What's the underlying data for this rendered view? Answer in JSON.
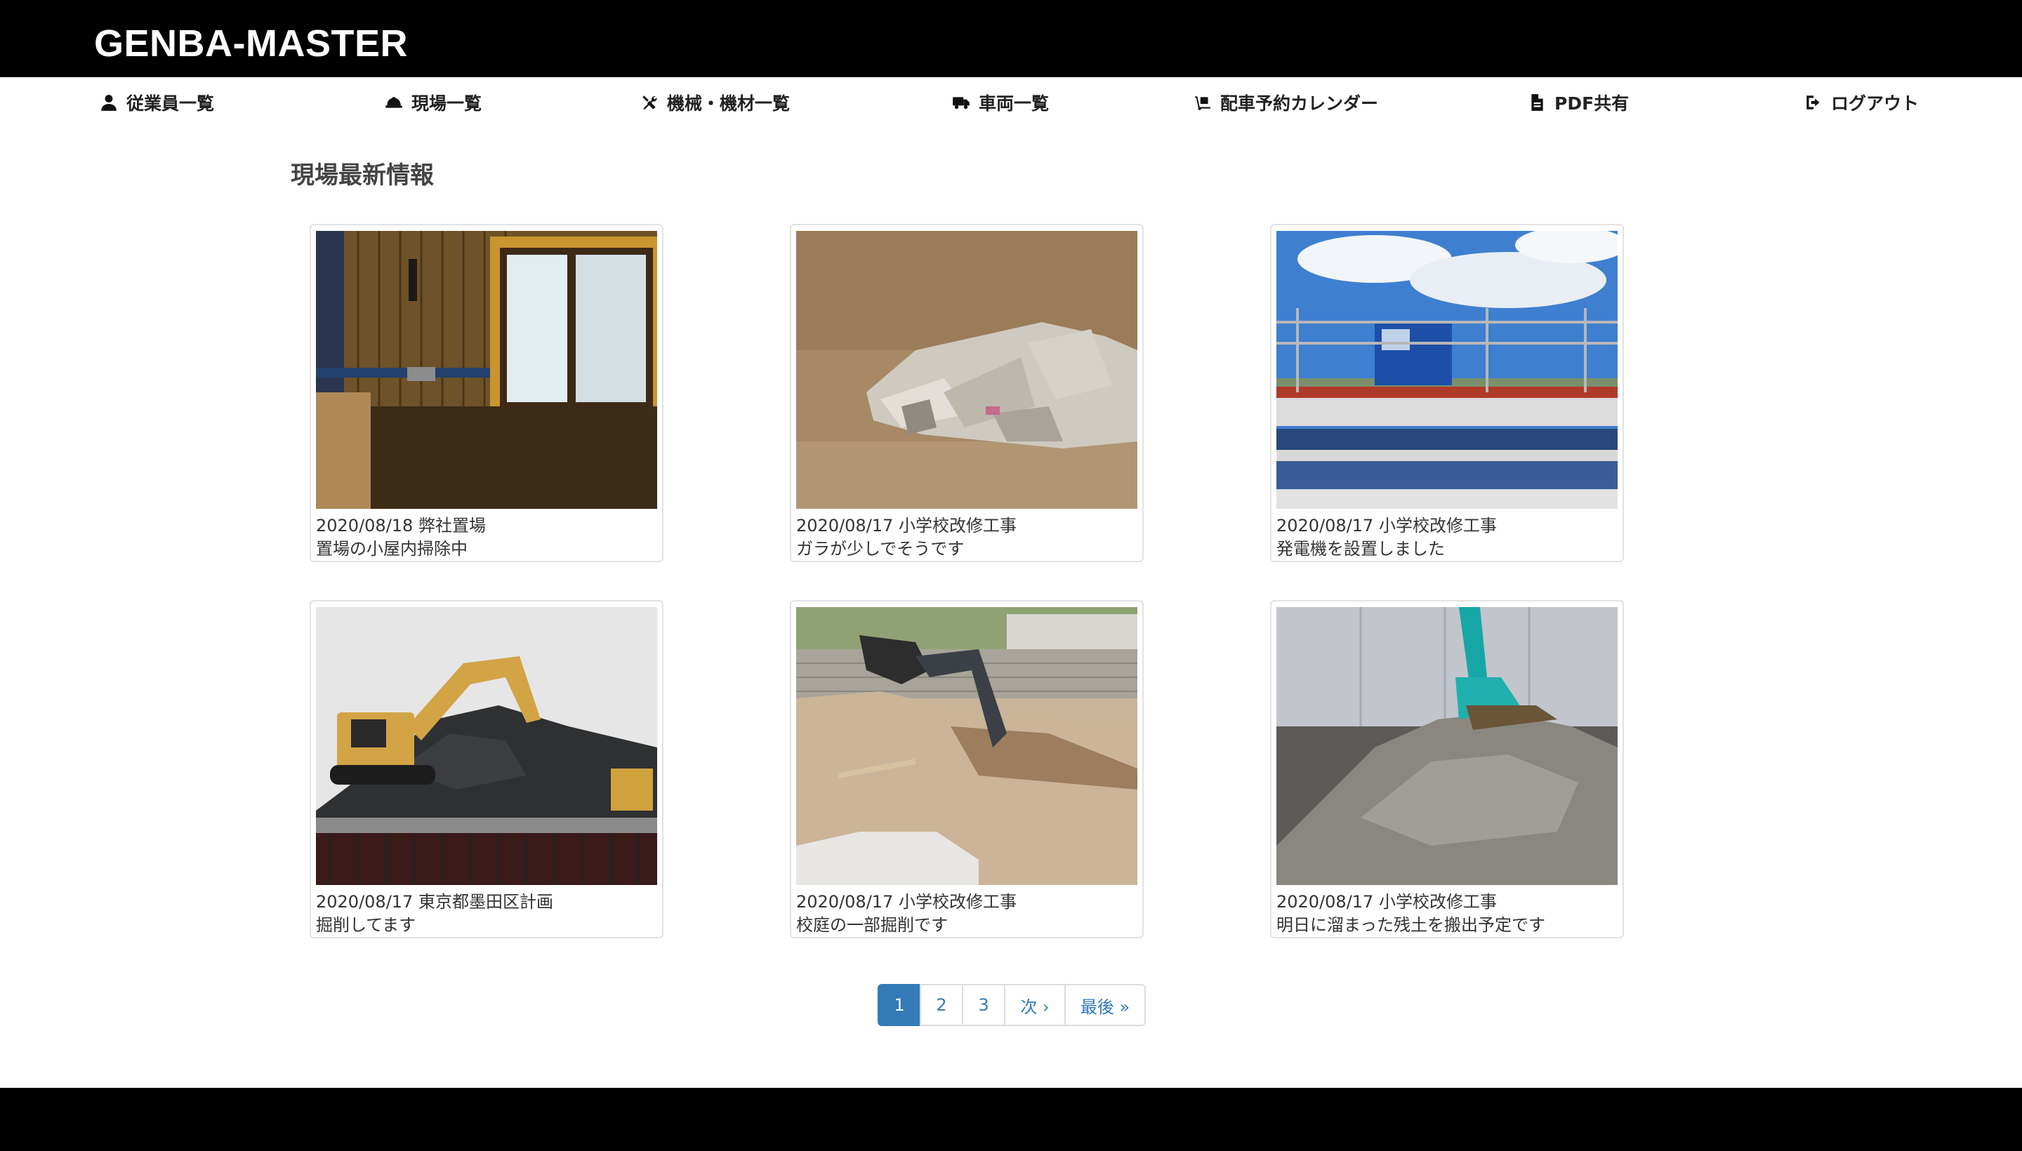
{
  "header": {
    "brand": "GENBA-MASTER"
  },
  "nav": {
    "employees": "従業員一覧",
    "sites": "現場一覧",
    "machines": "機械・機材一覧",
    "vehicles": "車両一覧",
    "dispatch_calendar": "配車予約カレンダー",
    "pdf_share": "PDF共有",
    "logout": "ログアウト"
  },
  "main": {
    "title": "現場最新情報",
    "posts": [
      {
        "meta": "2020/08/18 弊社置場",
        "comment": "置場の小屋内掃除中"
      },
      {
        "meta": "2020/08/17 小学校改修工事",
        "comment": "ガラが少しでそうです"
      },
      {
        "meta": "2020/08/17 小学校改修工事",
        "comment": "発電機を設置しました"
      },
      {
        "meta": "2020/08/17 東京都墨田区計画",
        "comment": "掘削してます"
      },
      {
        "meta": "2020/08/17 小学校改修工事",
        "comment": "校庭の一部掘削です"
      },
      {
        "meta": "2020/08/17 小学校改修工事",
        "comment": "明日に溜まった残土を搬出予定です"
      }
    ]
  },
  "pagination": {
    "pages": [
      "1",
      "2",
      "3"
    ],
    "current": "1",
    "next": "次 ›",
    "last": "最後 »"
  },
  "colors": {
    "topbar": "#000000",
    "footer": "#000000",
    "link": "#337ab7",
    "active_page": "#337ab7"
  },
  "icons": {
    "employees": "user-icon",
    "sites": "hard-hat-icon",
    "machines": "tools-icon",
    "vehicles": "truck-icon",
    "dispatch_calendar": "dolly-icon",
    "pdf_share": "pdf-file-icon",
    "logout": "sign-out-icon"
  }
}
